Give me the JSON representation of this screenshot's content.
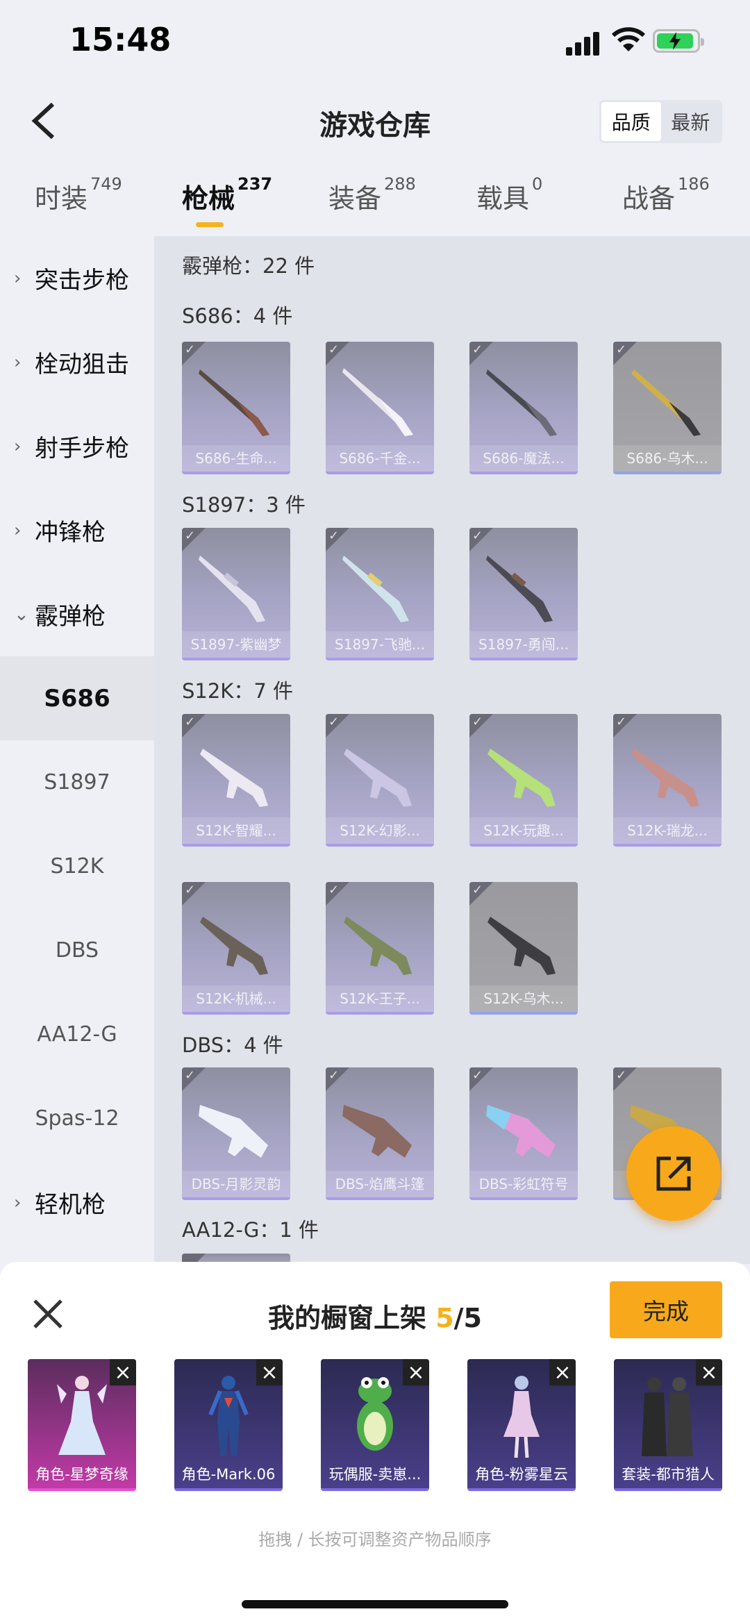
{
  "status": {
    "time": "15:48"
  },
  "header": {
    "title": "游戏仓库",
    "sort": [
      "品质",
      "最新"
    ]
  },
  "tabs": [
    {
      "label": "时装",
      "count": "749"
    },
    {
      "label": "枪械",
      "count": "237"
    },
    {
      "label": "装备",
      "count": "288"
    },
    {
      "label": "载具",
      "count": "0"
    },
    {
      "label": "战备",
      "count": "186"
    }
  ],
  "sidebar": [
    "突击步枪",
    "栓动狙击",
    "射手步枪",
    "冲锋枪",
    "霰弹枪",
    "S686",
    "S1897",
    "S12K",
    "DBS",
    "AA12-G",
    "Spas-12",
    "轻机枪"
  ],
  "content": {
    "total": "霰弹枪：22 件",
    "groups": [
      {
        "label": "S686：4 件",
        "items": [
          "S686-生命...",
          "S686-千金...",
          "S686-魔法...",
          "S686-乌木..."
        ]
      },
      {
        "label": "S1897：3 件",
        "items": [
          "S1897-紫幽梦",
          "S1897-飞驰...",
          "S1897-勇闯..."
        ]
      },
      {
        "label": "S12K：7 件",
        "items": [
          "S12K-智耀...",
          "S12K-幻影...",
          "S12K-玩趣...",
          "S12K-瑞龙...",
          "S12K-机械...",
          "S12K-王子...",
          "S12K-乌木..."
        ]
      },
      {
        "label": "DBS：4 件",
        "items": [
          "DBS-月影灵韵",
          "DBS-焰鹰斗篷",
          "DBS-彩虹符号",
          "D..."
        ]
      },
      {
        "label": "AA12-G：1 件"
      }
    ]
  },
  "sheet": {
    "title_pre": "我的橱窗上架 ",
    "count": "5",
    "title_post": "/5",
    "done": "完成",
    "hint": "拖拽 / 长按可调整资产物品顺序",
    "slots": [
      "角色-星梦奇缘",
      "角色-Mark.06",
      "玩偶服-卖崽...",
      "角色-粉雾星云",
      "套装-都市猎人"
    ]
  },
  "colors": {
    "accent": "#f7a91b"
  }
}
